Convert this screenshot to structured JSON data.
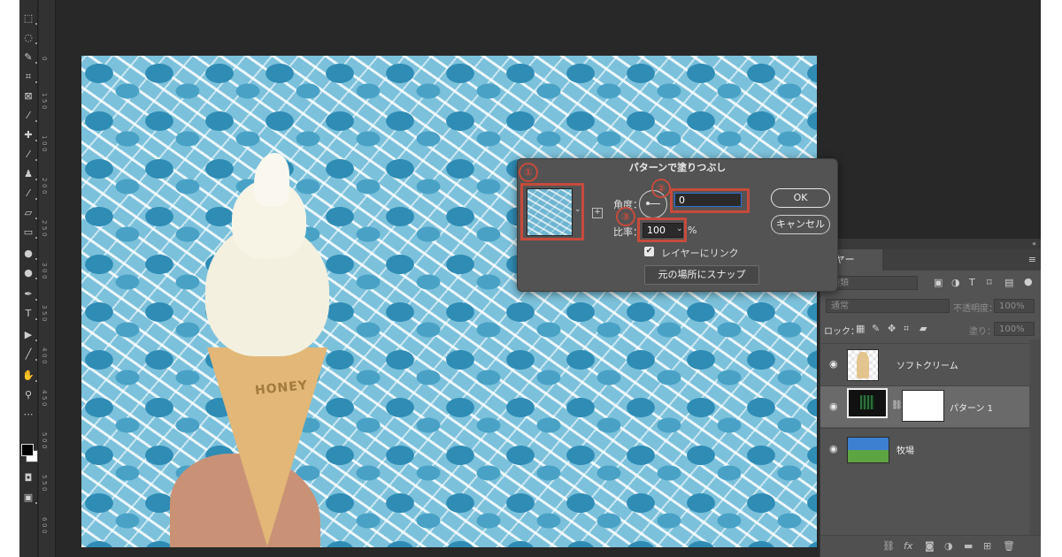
{
  "dialog": {
    "title": "パターンで塗りつぶし",
    "angle_label": "角度：",
    "angle_value": "0",
    "scale_label": "比率：",
    "scale_value": "100",
    "scale_unit": "%",
    "link_label": "レイヤーにリンク",
    "link_checked": true,
    "snap_label": "元の場所にスナップ",
    "ok_label": "OK",
    "cancel_label": "キャンセル",
    "markers": [
      "①",
      "②",
      "③"
    ],
    "highlight_color": "#c64b3c"
  },
  "ruler": {
    "ticks": [
      "0",
      "1",
      "5",
      "0",
      "1",
      "0",
      "0",
      "2",
      "0",
      "0",
      "2",
      "5",
      "0",
      "3",
      "0",
      "0",
      "3",
      "5",
      "0",
      "4",
      "0",
      "0",
      "4",
      "5",
      "0",
      "5",
      "0",
      "0",
      "5",
      "5",
      "0",
      "6",
      "0",
      "0"
    ]
  },
  "canvas": {
    "cone_text": "HONEY"
  },
  "layers_panel": {
    "tab": "イヤー",
    "kind_placeholder": "種類",
    "blend_mode": "通常",
    "opacity_label": "不透明度：",
    "opacity_value": "100%",
    "lock_label": "ロック：",
    "fill_label": "塗り：",
    "fill_value": "100%",
    "layers": [
      {
        "name": "ソフトクリーム",
        "selected": false
      },
      {
        "name": "パターン 1",
        "selected": true
      },
      {
        "name": "牧場",
        "selected": false
      }
    ]
  }
}
